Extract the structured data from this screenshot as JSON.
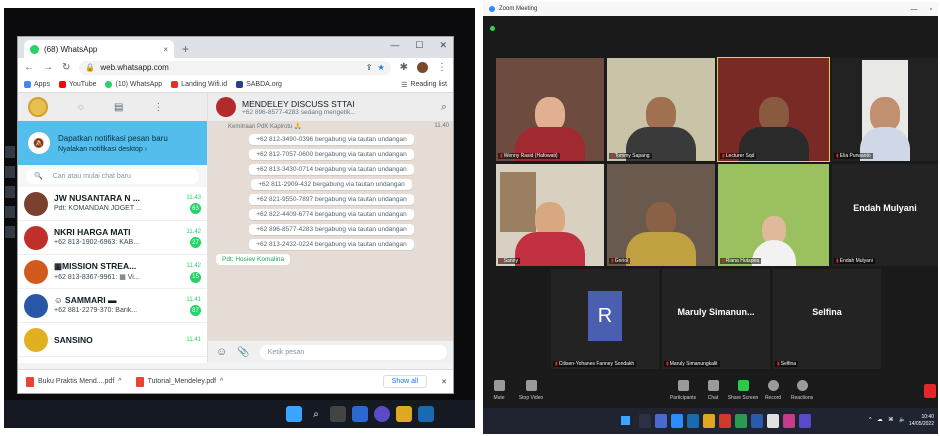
{
  "left": {
    "chrome": {
      "tab_title": "(68) WhatsApp",
      "tab_close": "×",
      "new_tab": "+",
      "win_min": "—",
      "win_max": "☐",
      "win_close": "✕",
      "url": "web.whatsapp.com",
      "bookmarks": [
        "Apps",
        "YouTube",
        "(10) WhatsApp",
        "Landing Wifi.id",
        "SABDA.org"
      ],
      "reading_list": "Reading list"
    },
    "whatsapp": {
      "notification_title": "Dapatkan notifikasi pesan baru",
      "notification_sub": "Nyalakan notifikasi desktop ›",
      "search_placeholder": "Cari atau mulai chat baru",
      "chats": [
        {
          "name": "JW NUSANTARA N ...",
          "time": "11.43",
          "preview": "Pdt: KOMANDAN JOGET ...",
          "badge": "63",
          "color": "#7a4030"
        },
        {
          "name": "NKRI HARGA MATI",
          "time": "11.42",
          "preview": "+62 813-1902-6963: KAB...",
          "badge": "27",
          "color": "#c0302a"
        },
        {
          "name": "▦MISSION STREA...",
          "time": "11.42",
          "preview": "+62 813-8367-9961: ▦ Vi...",
          "badge": "15",
          "color": "#d35a1e"
        },
        {
          "name": "☺ SAMMARI ▬",
          "time": "11.41",
          "preview": "+62 881-2279-370: Barik...",
          "badge": "87",
          "color": "#2a56a8"
        },
        {
          "name": "SANSINO",
          "time": "11.41",
          "preview": "",
          "badge": "",
          "color": "#e0b020"
        }
      ],
      "group_name": "MENDELEY DISCUSS STTAI",
      "group_sub": "+62 896-8577-4283 sedang mengetik...",
      "top_snippet": "Kemitraan PdK Kapirotu 🙏",
      "top_snippet_time": "11.40",
      "system_messages": [
        "+62 812-3490-0396 bergabung via tautan undangan",
        "+62 812-7057-0600 bergabung via tautan undangan",
        "+62 813-3430-0714 bergabung via tautan undangan",
        "+62 811-2909-432 bergabung via tautan undangan",
        "+62 821-9550-7897 bergabung via tautan undangan",
        "+62 822-4409-6774 bergabung via tautan undangan",
        "+62 896-8577-4283 bergabung via tautan undangan",
        "+62 813-2432-0224 bergabung via tautan undangan"
      ],
      "last_message": "Pdt: Hosiev Komalina",
      "compose_placeholder": "Ketik pesan"
    },
    "downloads": {
      "items": [
        "Buku Praktis Mend....pdf",
        "Tutorial_Mendeley.pdf"
      ],
      "chevron": "^",
      "show_all": "Show all",
      "close": "✕"
    }
  },
  "zoom": {
    "title": "Zoom Meeting",
    "win_min": "—",
    "win_max": "▫",
    "participants": [
      {
        "name": "Wenny Rasid (Hafowati)",
        "big": ""
      },
      {
        "name": "Tommy Sapang",
        "big": ""
      },
      {
        "name": "Lecturer Sqd",
        "big": ""
      },
      {
        "name": "Elia Purwanto",
        "big": ""
      },
      {
        "name": "Sanny",
        "big": ""
      },
      {
        "name": "Gnriol",
        "big": ""
      },
      {
        "name": "Riana Hutapea",
        "big": ""
      },
      {
        "name": "Endah Mulyani",
        "big": "Endah Mulyani"
      },
      {
        "name": "Citisen-Yohanes Fanney Sondakh",
        "big": "R"
      },
      {
        "name": "Maruly Simanungkalit",
        "big": "Maruly Simanun..."
      },
      {
        "name": "Selfina",
        "big": "Selfina"
      }
    ],
    "toolbar": [
      "Mute",
      "Stop Video",
      "Participants",
      "Chat",
      "Share Screen",
      "Record",
      "Reactions"
    ],
    "participants_count": "11",
    "clock_time": "10:40",
    "clock_date": "14/05/2022",
    "tray": "^ ☁ ⌘ 🔈"
  }
}
